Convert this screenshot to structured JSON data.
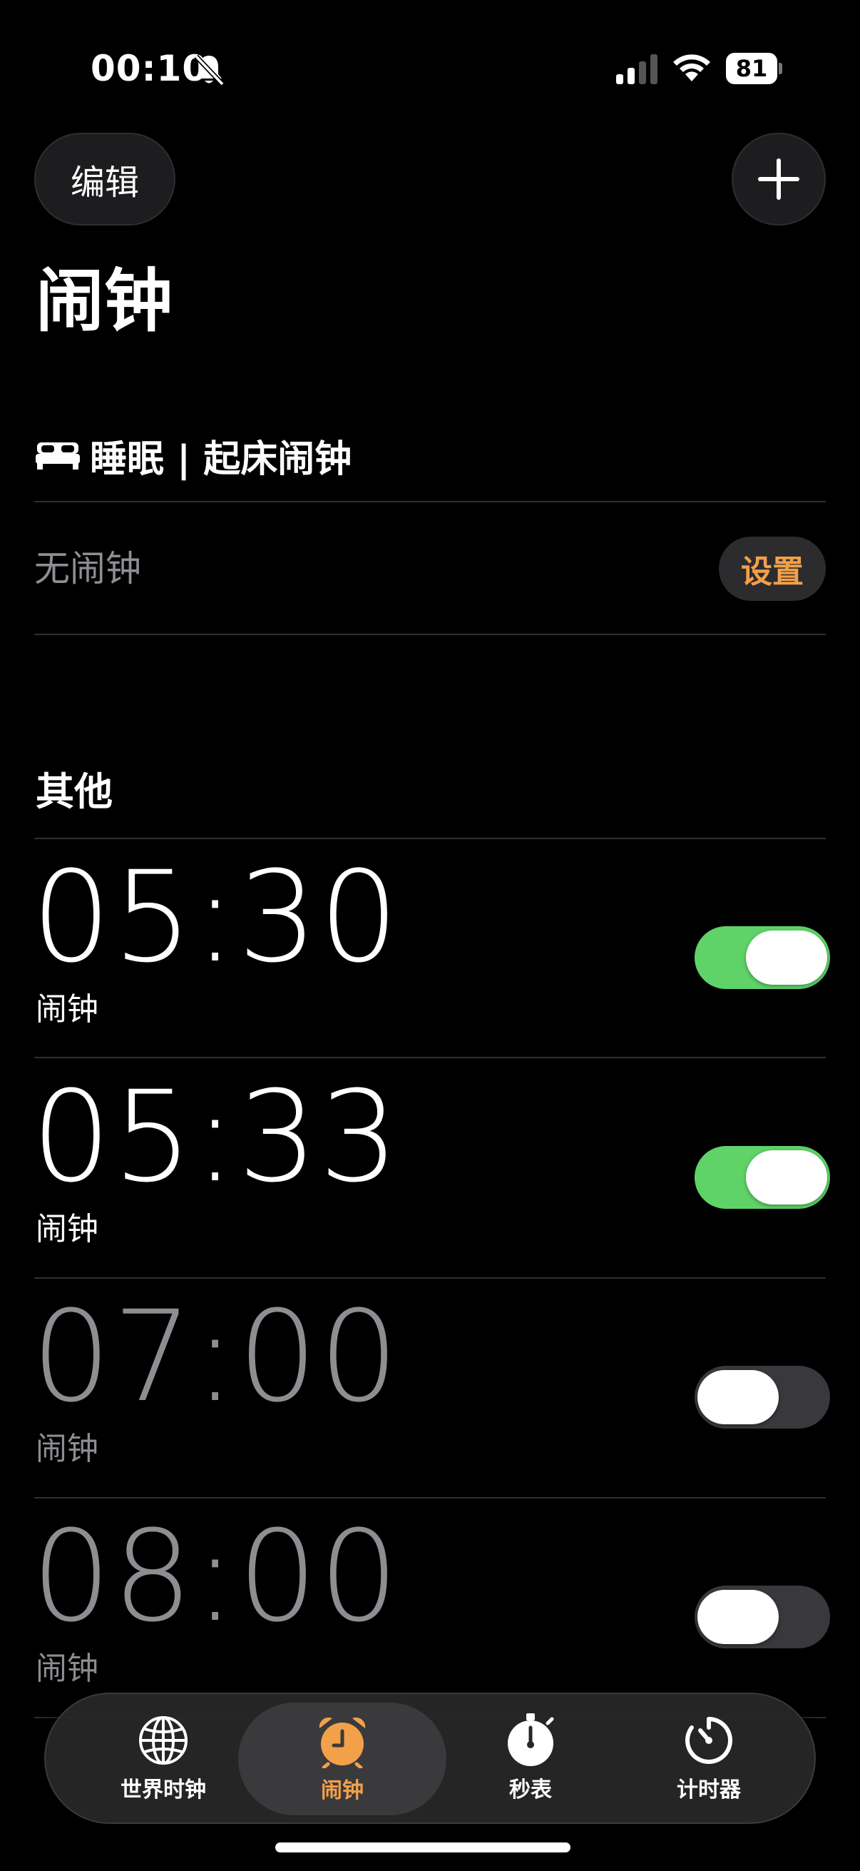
{
  "status_bar": {
    "time": "00:10",
    "battery_percent": "81",
    "icons": [
      "bell-slash-icon",
      "cellular-signal-icon",
      "wifi-icon",
      "battery-icon"
    ]
  },
  "header": {
    "edit_label": "编辑",
    "add_icon": "plus-icon",
    "title": "闹钟"
  },
  "sleep": {
    "icon": "bed-icon",
    "title": "睡眠 | 起床闹钟",
    "status": "无闹钟",
    "setup_label": "设置"
  },
  "others": {
    "title": "其他",
    "alarms": [
      {
        "time": "05:30",
        "label": "闹钟",
        "enabled": true
      },
      {
        "time": "05:33",
        "label": "闹钟",
        "enabled": true
      },
      {
        "time": "07:00",
        "label": "闹钟",
        "enabled": false
      },
      {
        "time": "08:00",
        "label": "闹钟",
        "enabled": false
      }
    ]
  },
  "tab_bar": {
    "tabs": [
      {
        "label": "世界时钟",
        "icon": "globe-icon",
        "active": false
      },
      {
        "label": "闹钟",
        "icon": "alarm-clock-icon",
        "active": true
      },
      {
        "label": "秒表",
        "icon": "stopwatch-icon",
        "active": false
      },
      {
        "label": "计时器",
        "icon": "timer-icon",
        "active": false
      }
    ]
  },
  "colors": {
    "accent": "#f3a04a",
    "toggle_on": "#5fd368",
    "toggle_off": "#39393d",
    "background": "#000000"
  }
}
